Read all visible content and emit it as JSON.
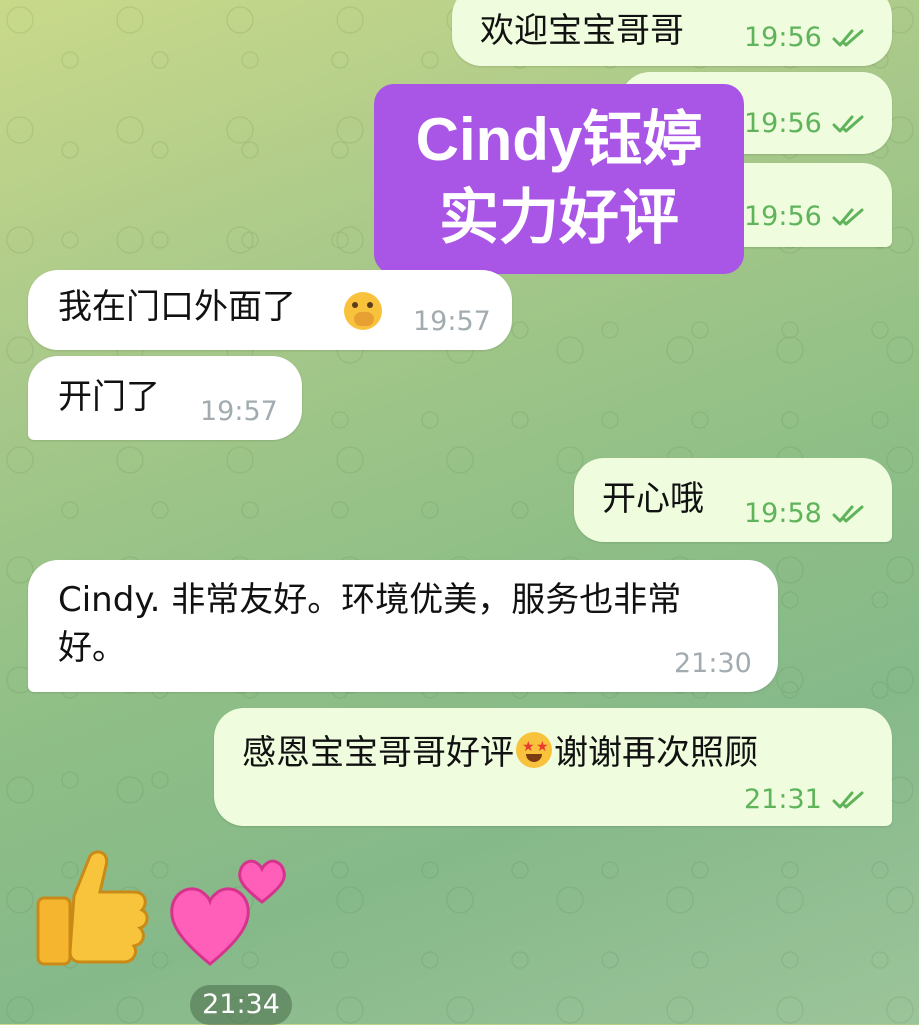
{
  "messages": [
    {
      "text": "欢迎宝宝哥哥",
      "time": "19:56",
      "dir": "out"
    },
    {
      "text": "",
      "time": "19:56",
      "dir": "out"
    },
    {
      "text": "",
      "time": "19:56",
      "dir": "out"
    },
    {
      "text": "我在门口外面了",
      "time": "19:57",
      "dir": "in"
    },
    {
      "text": "开门了",
      "time": "19:57",
      "dir": "in"
    },
    {
      "text": "开心哦",
      "time": "19:58",
      "dir": "out"
    },
    {
      "text": "Cindy. 非常友好。环境优美，服务也非常好。",
      "time": "21:30",
      "dir": "in"
    },
    {
      "text": "感恩宝宝哥哥好评",
      "text_after": "谢谢再次照顾",
      "time": "21:31",
      "dir": "out"
    }
  ],
  "overlay": {
    "line1": "Cindy钰婷",
    "line2": "实力好评"
  },
  "sticker": {
    "time": "21:34",
    "items": [
      "thumbs-up-icon",
      "two-hearts-icon"
    ]
  },
  "colors": {
    "overlay": "#a955e6",
    "outgoing_bubble": "#effdde",
    "incoming_bubble": "#ffffff",
    "tick": "#5fb35a"
  }
}
